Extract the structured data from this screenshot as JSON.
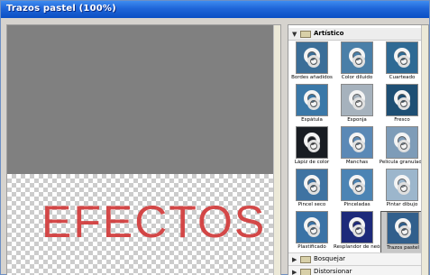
{
  "window": {
    "title": "Trazos pastel (100%)"
  },
  "preview": {
    "text": "EFECTOS"
  },
  "gallery": {
    "open_group": "Artístico",
    "closed_groups": [
      "Bosquejar",
      "Distorsionar"
    ],
    "filters": [
      {
        "label": "Bordes añadidos",
        "bg": "#3b6e98",
        "selected": false
      },
      {
        "label": "Color diluido",
        "bg": "#4a7fa8",
        "selected": false
      },
      {
        "label": "Cuarteado",
        "bg": "#2f6a94",
        "selected": false
      },
      {
        "label": "Espátula",
        "bg": "#3a78a8",
        "selected": false
      },
      {
        "label": "Esponja",
        "bg": "#a6b2bd",
        "selected": false
      },
      {
        "label": "Fresco",
        "bg": "#1e4f74",
        "selected": false
      },
      {
        "label": "Lápiz de color",
        "bg": "#181c22",
        "selected": false
      },
      {
        "label": "Manchas",
        "bg": "#5b89b6",
        "selected": false
      },
      {
        "label": "Película granulada",
        "bg": "#7e9cb8",
        "selected": false
      },
      {
        "label": "Pincel seco",
        "bg": "#3f73a2",
        "selected": false
      },
      {
        "label": "Pinceladas",
        "bg": "#4c84b4",
        "selected": false
      },
      {
        "label": "Pintar dibujo",
        "bg": "#9cb6cc",
        "selected": false
      },
      {
        "label": "Plastificado",
        "bg": "#3b73a6",
        "selected": false
      },
      {
        "label": "Resplandor de neón",
        "bg": "#1d2a7a",
        "selected": false
      },
      {
        "label": "Trazos pastel",
        "bg": "#315f8c",
        "selected": true
      }
    ]
  }
}
